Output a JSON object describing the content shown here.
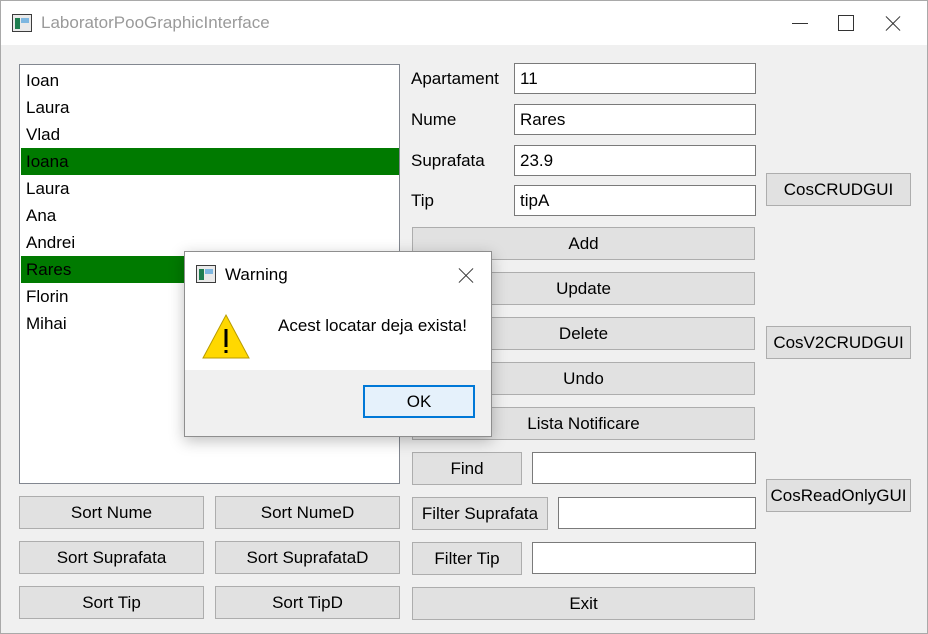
{
  "window": {
    "title": "LaboratorPooGraphicInterface"
  },
  "list": {
    "items": [
      {
        "label": "Ioan",
        "selected": false
      },
      {
        "label": "Laura",
        "selected": false
      },
      {
        "label": "Vlad",
        "selected": false
      },
      {
        "label": "Ioana",
        "selected": true
      },
      {
        "label": "Laura",
        "selected": false
      },
      {
        "label": "Ana",
        "selected": false
      },
      {
        "label": "Andrei",
        "selected": false
      },
      {
        "label": "Rares",
        "selected": true
      },
      {
        "label": "Florin",
        "selected": false
      },
      {
        "label": "Mihai",
        "selected": false
      }
    ],
    "selection_color": "#007a00"
  },
  "form": {
    "apartament_label": "Apartament",
    "apartament_value": "11",
    "nume_label": "Nume",
    "nume_value": "Rares",
    "suprafata_label": "Suprafata",
    "suprafata_value": "23.9",
    "tip_label": "Tip",
    "tip_value": "tipA"
  },
  "actions": {
    "add": "Add",
    "update": "Update",
    "delete": "Delete",
    "undo": "Undo",
    "lista_notificare": "Lista Notificare",
    "find": "Find",
    "filter_suprafata": "Filter Suprafata",
    "filter_tip": "Filter Tip",
    "exit": "Exit",
    "find_value": "",
    "filter_suprafata_value": "",
    "filter_tip_value": ""
  },
  "sort": {
    "nume": "Sort Nume",
    "nume_d": "Sort NumeD",
    "suprafata": "Sort Suprafata",
    "suprafata_d": "Sort SuprafataD",
    "tip": "Sort Tip",
    "tip_d": "Sort TipD"
  },
  "side": {
    "cos_crud": "CosCRUDGUI",
    "cos_v2_crud": "CosV2CRUDGUI",
    "cos_read_only": "CosReadOnlyGUI"
  },
  "dialog": {
    "title": "Warning",
    "message": "Acest locatar deja exista!",
    "ok": "OK"
  }
}
